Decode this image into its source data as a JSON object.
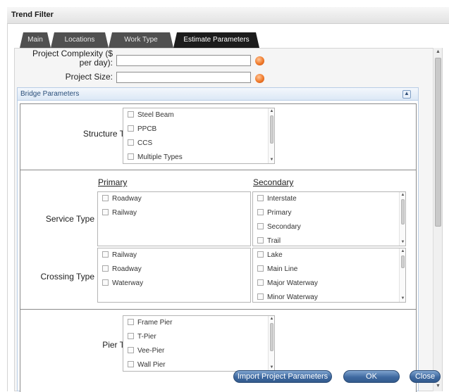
{
  "window": {
    "title": "Trend Filter"
  },
  "tabs": [
    {
      "label": "Main"
    },
    {
      "label": "Locations"
    },
    {
      "label": "Work Type"
    },
    {
      "label": "Estimate Parameters",
      "active": true
    }
  ],
  "fields": {
    "project_complexity": {
      "label_line1": "Project Complexity ($",
      "label_line2": "per day):",
      "value": ""
    },
    "project_size": {
      "label": "Project Size:",
      "value": ""
    }
  },
  "bridge": {
    "header": "Bridge Parameters",
    "structure_type": {
      "label": "Structure Type:",
      "options": [
        "Steel Beam",
        "PPCB",
        "CCS",
        "Multiple Types"
      ]
    },
    "columns": {
      "primary": "Primary",
      "secondary": "Secondary"
    },
    "service_type": {
      "label": "Service Type",
      "primary": [
        "Roadway",
        "Railway"
      ],
      "secondary": [
        "Interstate",
        "Primary",
        "Secondary",
        "Trail"
      ]
    },
    "crossing_type": {
      "label": "Crossing Type",
      "primary": [
        "Railway",
        "Roadway",
        "Waterway"
      ],
      "secondary": [
        "Lake",
        "Main Line",
        "Major Waterway",
        "Minor Waterway"
      ]
    },
    "pier_type": {
      "label": "Pier Type:",
      "options": [
        "Frame Pier",
        "T-Pier",
        "Vee-Pier",
        "Wall Pier"
      ]
    }
  },
  "buttons": {
    "import": "Import Project Parameters",
    "ok": "OK",
    "close": "Close"
  },
  "colors": {
    "tab_active": "#1c1c1c",
    "tab_inactive": "#505050",
    "button_blue": "#3f6aa1",
    "orb_orange": "#f07a2a",
    "panel_header": "#dce8f6"
  }
}
